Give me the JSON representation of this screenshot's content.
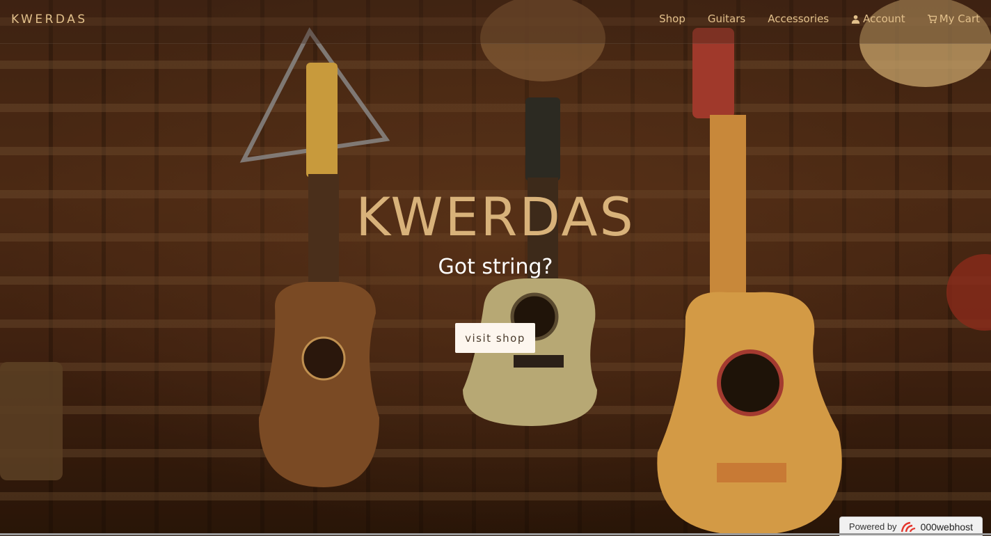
{
  "header": {
    "brand": "KWERDAS",
    "nav": [
      {
        "label": "Shop",
        "icon": null
      },
      {
        "label": "Guitars",
        "icon": null
      },
      {
        "label": "Accessories",
        "icon": null
      },
      {
        "label": "Account",
        "icon": "user-icon"
      },
      {
        "label": "My Cart",
        "icon": "cart-icon"
      }
    ]
  },
  "hero": {
    "title": "KWERDAS",
    "subtitle": "Got string?",
    "cta_label": "visit shop"
  },
  "footer_badge": {
    "prefix": "Powered by",
    "name": "000webhost",
    "icon": "000webhost-logo-icon"
  },
  "colors": {
    "accent": "#d8b27a",
    "nav_text": "#e2c08b",
    "button_bg": "#fdf6ee"
  }
}
